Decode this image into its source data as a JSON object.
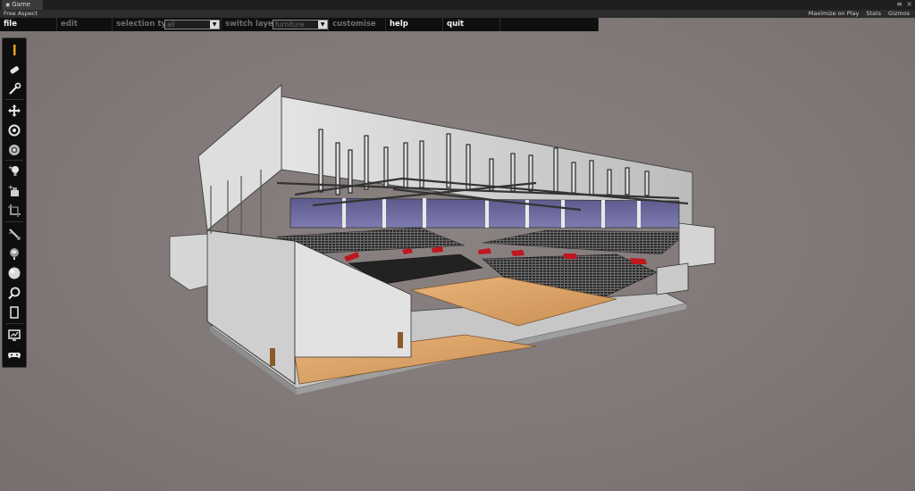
{
  "editor": {
    "tab_label": "Game",
    "aspect_label": "Free Aspect",
    "maximize_label": "Maximize on Play",
    "stats_label": "Stats",
    "gizmos_label": "Gizmos"
  },
  "menubar": {
    "file": "file",
    "edit": "edit",
    "selection_type_label": "selection type",
    "selection_type_value": "all",
    "switch_layer_label": "switch layer",
    "switch_layer_value": "furniture",
    "customise": "customise",
    "help": "help",
    "quit": "quit"
  },
  "toolbar": {
    "tools": [
      "pencil-icon",
      "eraser-icon",
      "wrench-icon",
      "move-icon",
      "rotate-icon",
      "target-icon",
      "add-light-icon",
      "add-object-icon",
      "crop-icon",
      "pipette-icon",
      "globe-icon",
      "sphere-icon",
      "zoom-icon",
      "page-icon",
      "screen-icon",
      "gamepad-icon"
    ],
    "active_tool": "pencil-icon"
  },
  "colors": {
    "menubar_bg": "#0f0f0f",
    "background": "#807878",
    "accent_orange": "#f0a020",
    "seat_red": "#c0161e",
    "floor_wood": "#d9a26a"
  }
}
